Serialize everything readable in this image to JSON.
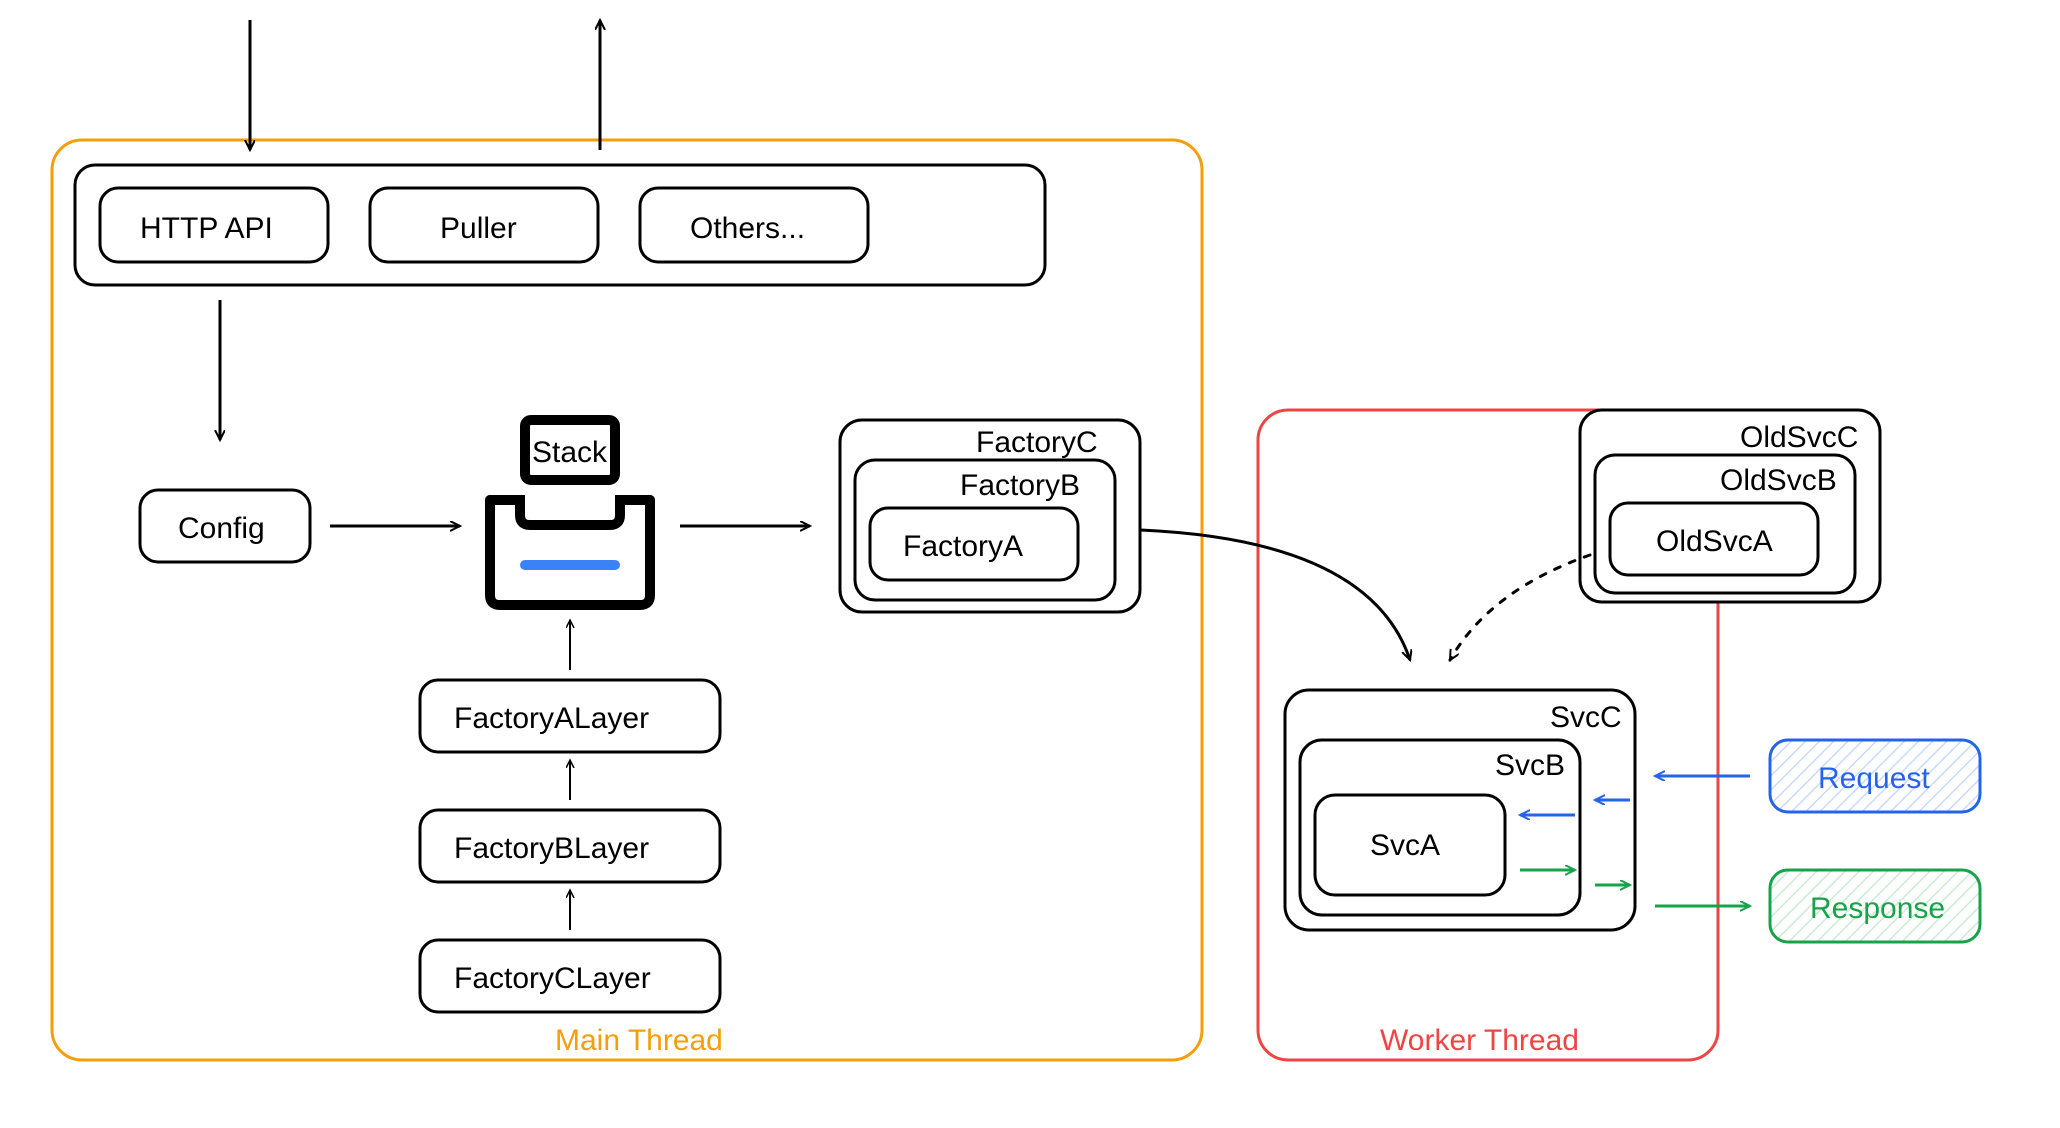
{
  "main_thread": {
    "label": "Main Thread",
    "topRow": [
      "HTTP API",
      "Puller",
      "Others..."
    ],
    "config": "Config",
    "stack_label": "Stack",
    "layers": [
      "FactoryALayer",
      "FactoryBLayer",
      "FactoryCLayer"
    ],
    "factories": {
      "a": "FactoryA",
      "b": "FactoryB",
      "c": "FactoryC"
    }
  },
  "worker_thread": {
    "label": "Worker Thread",
    "old": {
      "a": "OldSvcA",
      "b": "OldSvcB",
      "c": "OldSvcC"
    },
    "svc": {
      "a": "SvcA",
      "b": "SvcB",
      "c": "SvcC"
    },
    "request": "Request",
    "response": "Response"
  },
  "colors": {
    "orange": "#f59e0b",
    "red": "#ef4444",
    "blue": "#2563eb",
    "green": "#16a34a",
    "black": "#000000"
  }
}
